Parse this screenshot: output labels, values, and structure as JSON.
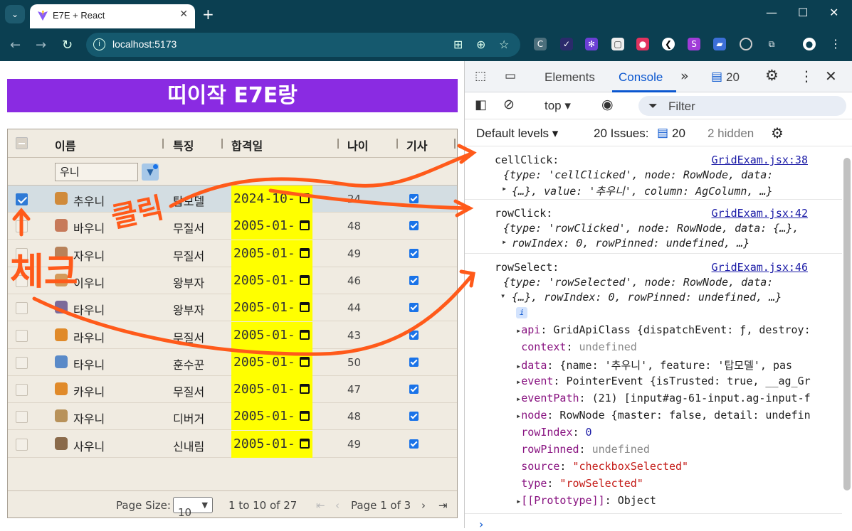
{
  "browser": {
    "tab_title": "E7E + React",
    "url": "localhost:5173"
  },
  "page": {
    "banner": "띠이작 E7E랑",
    "grid": {
      "headers": [
        "이름",
        "특징",
        "합격일",
        "나이",
        "기사"
      ],
      "filter_value": "우니",
      "rows": [
        {
          "name": "추우니",
          "feature": "탑모델",
          "date": "2024-10-",
          "age": "24",
          "selected": true,
          "kisa": true
        },
        {
          "name": "바우니",
          "feature": "무질서",
          "date": "2005-01-",
          "age": "48",
          "selected": false,
          "kisa": true
        },
        {
          "name": "자우니",
          "feature": "무질서",
          "date": "2005-01-",
          "age": "49",
          "selected": false,
          "kisa": true
        },
        {
          "name": "이우니",
          "feature": "왕부자",
          "date": "2005-01-",
          "age": "46",
          "selected": false,
          "kisa": true
        },
        {
          "name": "타우니",
          "feature": "왕부자",
          "date": "2005-01-",
          "age": "44",
          "selected": false,
          "kisa": true
        },
        {
          "name": "라우니",
          "feature": "무질서",
          "date": "2005-01-",
          "age": "43",
          "selected": false,
          "kisa": true
        },
        {
          "name": "타우니",
          "feature": "훈수꾼",
          "date": "2005-01-",
          "age": "50",
          "selected": false,
          "kisa": true
        },
        {
          "name": "카우니",
          "feature": "무질서",
          "date": "2005-01-",
          "age": "47",
          "selected": false,
          "kisa": true
        },
        {
          "name": "자우니",
          "feature": "디버거",
          "date": "2005-01-",
          "age": "48",
          "selected": false,
          "kisa": true
        },
        {
          "name": "사우니",
          "feature": "신내림",
          "date": "2005-01-",
          "age": "49",
          "selected": false,
          "kisa": true
        }
      ],
      "footer": {
        "page_size_label": "Page Size:",
        "page_size_value": "10",
        "range_text": "1 to 10 of 27",
        "page_text": "Page 1 of 3"
      }
    }
  },
  "devtools": {
    "tabs": [
      "Elements",
      "Console"
    ],
    "issues_badge": "20",
    "context": "top",
    "filter_placeholder": "Filter",
    "levels": "Default levels",
    "issues_text": "20 Issues:",
    "issues_count": "20",
    "hidden_text": "2 hidden",
    "messages": [
      {
        "label": "cellClick:",
        "source": "GridExam.jsx:38",
        "line1": "{type: 'cellClicked', node: RowNode, data:",
        "line2": "{…}, value: '추우니', column: AgColumn, …}"
      },
      {
        "label": "rowClick:",
        "source": "GridExam.jsx:42",
        "line1": "{type: 'rowClicked', node: RowNode, data: {…},",
        "line2": "rowIndex: 0, rowPinned: undefined, …}"
      },
      {
        "label": "rowSelect:",
        "source": "GridExam.jsx:46",
        "line1": "{type: 'rowSelected', node: RowNode, data:",
        "line2": "{…}, rowIndex: 0, rowPinned: undefined, …}"
      }
    ],
    "props": [
      {
        "key": "api",
        "value": "GridApiClass {dispatchEvent: ƒ, destroy:",
        "arrow": true
      },
      {
        "key": "context",
        "value": "undefined",
        "arrow": false
      },
      {
        "key": "data",
        "value": "{name: '추우니', feature: '탑모델', pas",
        "arrow": true
      },
      {
        "key": "event",
        "value": "PointerEvent {isTrusted: true, __ag_Gr",
        "arrow": true
      },
      {
        "key": "eventPath",
        "value": "(21) [input#ag-61-input.ag-input-f",
        "arrow": true
      },
      {
        "key": "node",
        "value": "RowNode {master: false, detail: undefin",
        "arrow": true
      },
      {
        "key": "rowIndex",
        "value": "0",
        "arrow": false
      },
      {
        "key": "rowPinned",
        "value": "undefined",
        "arrow": false
      },
      {
        "key": "source",
        "value": "\"checkboxSelected\"",
        "arrow": false
      },
      {
        "key": "type",
        "value": "\"rowSelected\"",
        "arrow": false
      },
      {
        "key": "[[Prototype]]",
        "value": "Object",
        "arrow": true
      }
    ]
  },
  "annotations": {
    "click_label": "클릭",
    "check_label": "체크"
  }
}
